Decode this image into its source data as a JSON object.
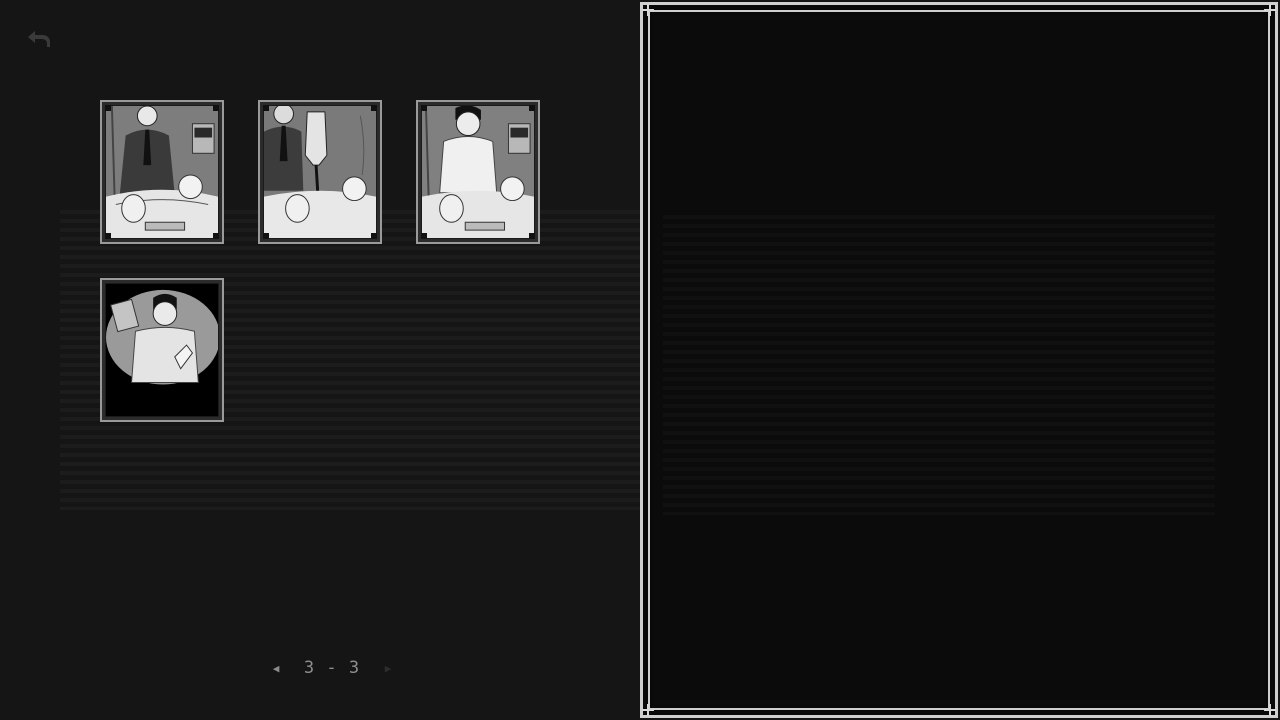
{
  "gallery": {
    "back_icon": "back-arrow-icon",
    "thumbnails": [
      {
        "id": "cg-1",
        "icon": "hospital-scene-suit-man-thumbnail"
      },
      {
        "id": "cg-2",
        "icon": "hospital-scene-iv-bag-thumbnail"
      },
      {
        "id": "cg-3",
        "icon": "hospital-scene-young-man-thumbnail"
      },
      {
        "id": "cg-4",
        "icon": "hospital-bed-vignette-thumbnail"
      }
    ],
    "pager": {
      "label": "3 - 3",
      "prev_icon": "triangle-left-icon",
      "next_icon": "triangle-right-icon"
    }
  },
  "viewer": {
    "state": "empty"
  },
  "colors": {
    "background": "#141414",
    "frame": "#cfcfcf",
    "thumb_border": "#9a9a9a",
    "viewer_bg": "#090909"
  }
}
